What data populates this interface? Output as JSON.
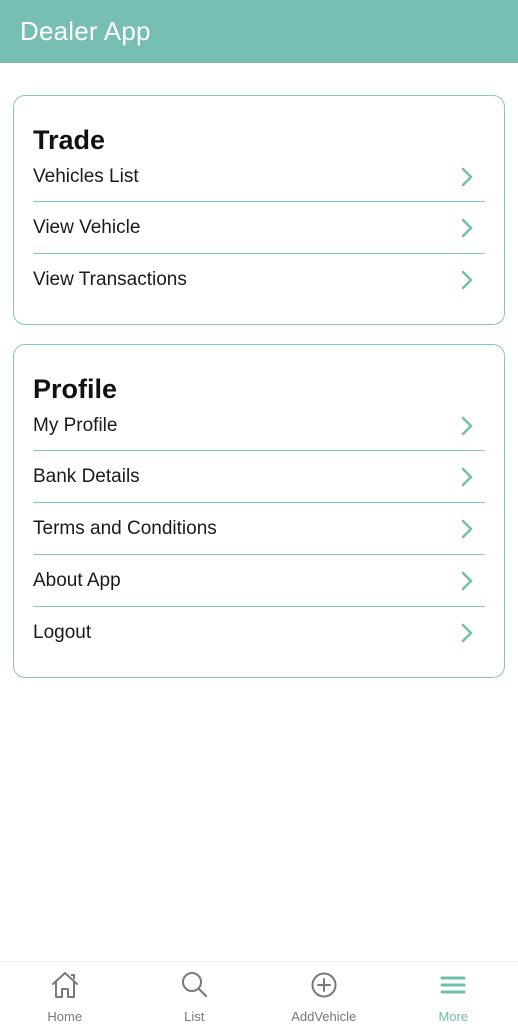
{
  "app": {
    "title": "Dealer App"
  },
  "colors": {
    "accent": "#76bfb2",
    "border": "#86c7bb",
    "inactive_nav": "#777777"
  },
  "trade": {
    "heading": "Trade",
    "items": [
      {
        "label": "Vehicles List",
        "icon": "chevron-right-icon"
      },
      {
        "label": "View Vehicle",
        "icon": "chevron-right-icon"
      },
      {
        "label": "View Transactions",
        "icon": "chevron-right-icon"
      }
    ]
  },
  "profile": {
    "heading": "Profile",
    "items": [
      {
        "label": "My Profile",
        "icon": "chevron-right-icon"
      },
      {
        "label": "Bank Details",
        "icon": "chevron-right-icon"
      },
      {
        "label": "Terms and Conditions",
        "icon": "chevron-right-icon"
      },
      {
        "label": "About App",
        "icon": "chevron-right-icon"
      },
      {
        "label": "Logout",
        "icon": "chevron-right-icon"
      }
    ]
  },
  "bottom_nav": {
    "items": [
      {
        "label": "Home",
        "icon": "home-icon",
        "active": false
      },
      {
        "label": "List",
        "icon": "search-icon",
        "active": false
      },
      {
        "label": "AddVehicle",
        "icon": "add-circle-icon",
        "active": false
      },
      {
        "label": "More",
        "icon": "menu-icon",
        "active": true
      }
    ]
  }
}
